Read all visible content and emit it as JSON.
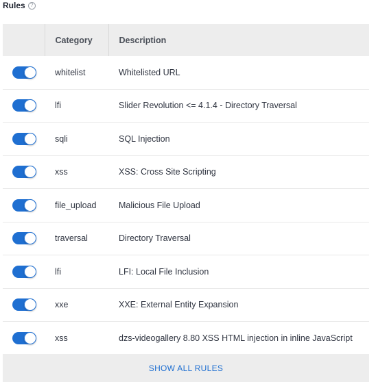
{
  "section": {
    "title": "Rules",
    "help_icon": "question-circle-icon"
  },
  "table": {
    "headers": {
      "toggle": "",
      "category": "Category",
      "description": "Description"
    },
    "rows": [
      {
        "enabled": true,
        "category": "whitelist",
        "description": "Whitelisted URL"
      },
      {
        "enabled": true,
        "category": "lfi",
        "description": "Slider Revolution <= 4.1.4 - Directory Traversal"
      },
      {
        "enabled": true,
        "category": "sqli",
        "description": "SQL Injection"
      },
      {
        "enabled": true,
        "category": "xss",
        "description": "XSS: Cross Site Scripting"
      },
      {
        "enabled": true,
        "category": "file_upload",
        "description": "Malicious File Upload"
      },
      {
        "enabled": true,
        "category": "traversal",
        "description": "Directory Traversal"
      },
      {
        "enabled": true,
        "category": "lfi",
        "description": "LFI: Local File Inclusion"
      },
      {
        "enabled": true,
        "category": "xxe",
        "description": "XXE: External Entity Expansion"
      },
      {
        "enabled": true,
        "category": "xss",
        "description": "dzs-videogallery 8.80 XSS HTML injection in inline JavaScript"
      }
    ]
  },
  "footer": {
    "show_all_label": "SHOW ALL RULES"
  },
  "colors": {
    "accent": "#1f6fd1",
    "header_bg": "#ededed"
  }
}
